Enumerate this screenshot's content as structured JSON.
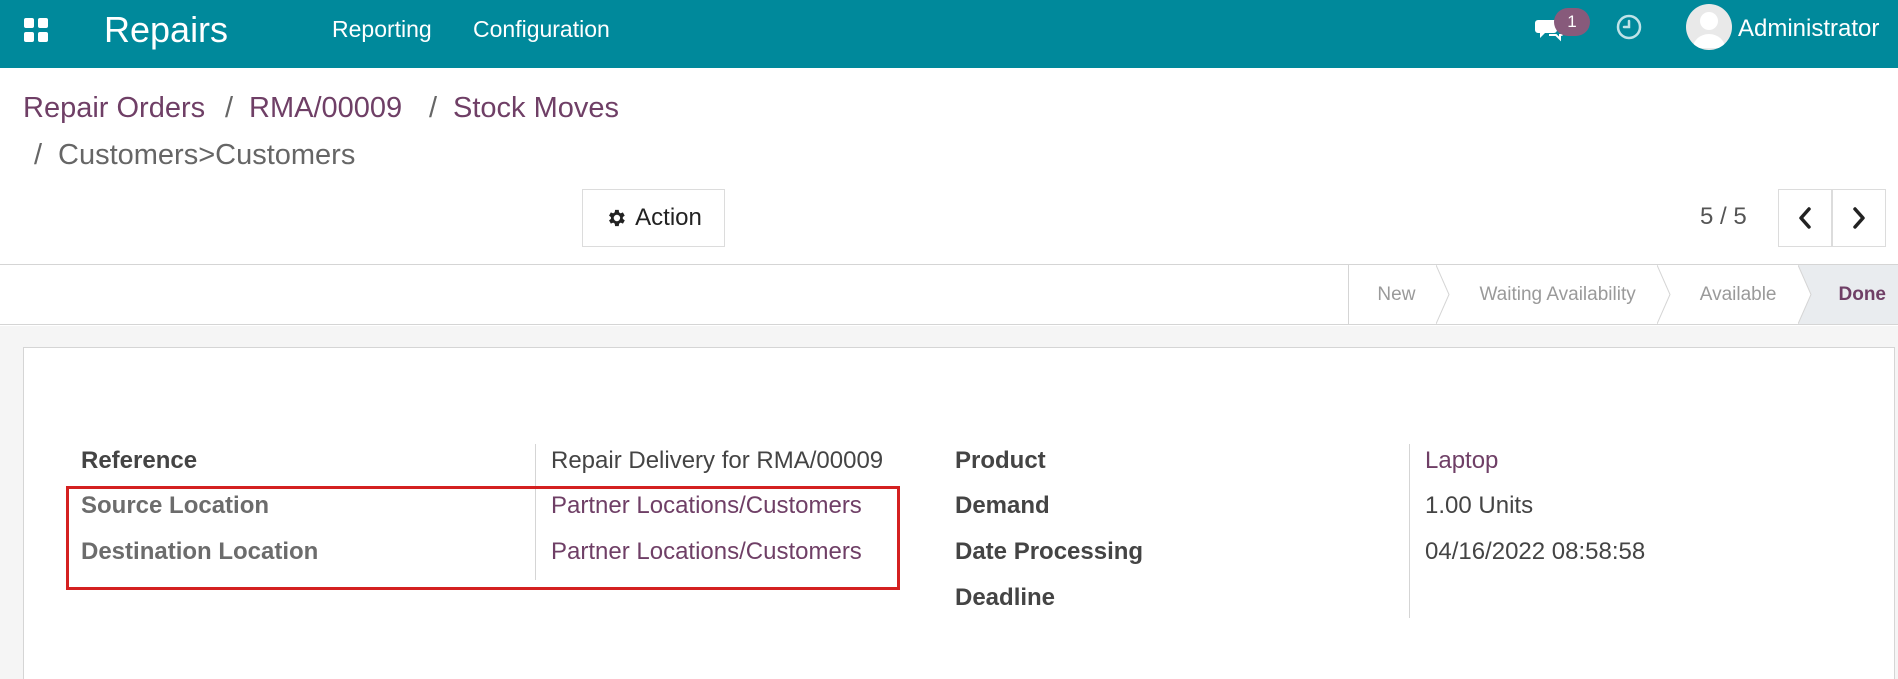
{
  "navbar": {
    "brand": "Repairs",
    "menu": [
      "Reporting",
      "Configuration"
    ],
    "chat_badge": "1",
    "user_name": "Administrator",
    "icons": [
      "apps-icon",
      "chat-icon",
      "clock-icon",
      "avatar"
    ]
  },
  "breadcrumb": {
    "items": [
      "Repair Orders",
      "RMA/00009",
      "Stock Moves"
    ],
    "separator": "/",
    "current": "Customers>Customers"
  },
  "toolbar": {
    "action_label": "Action",
    "pager": "5 / 5"
  },
  "status": {
    "stages": [
      "New",
      "Waiting Availability",
      "Available",
      "Done"
    ],
    "active": "Done"
  },
  "form": {
    "left": [
      {
        "label": "Reference",
        "value": "Repair Delivery for RMA/00009"
      },
      {
        "label": "Source Location",
        "value": "Partner Locations/Customers"
      },
      {
        "label": "Destination Location",
        "value": "Partner Locations/Customers"
      }
    ],
    "right": [
      {
        "label": "Product",
        "value": "Laptop"
      },
      {
        "label": "Demand",
        "value": "1.00",
        "unit": "Units"
      },
      {
        "label": "Date Processing",
        "value": "04/16/2022 08:58:58"
      },
      {
        "label": "Deadline",
        "value": ""
      }
    ]
  },
  "colors": {
    "navbar": "#00899b",
    "link": "#6f3f66",
    "badge": "#875a7b",
    "highlight": "#d42020"
  }
}
